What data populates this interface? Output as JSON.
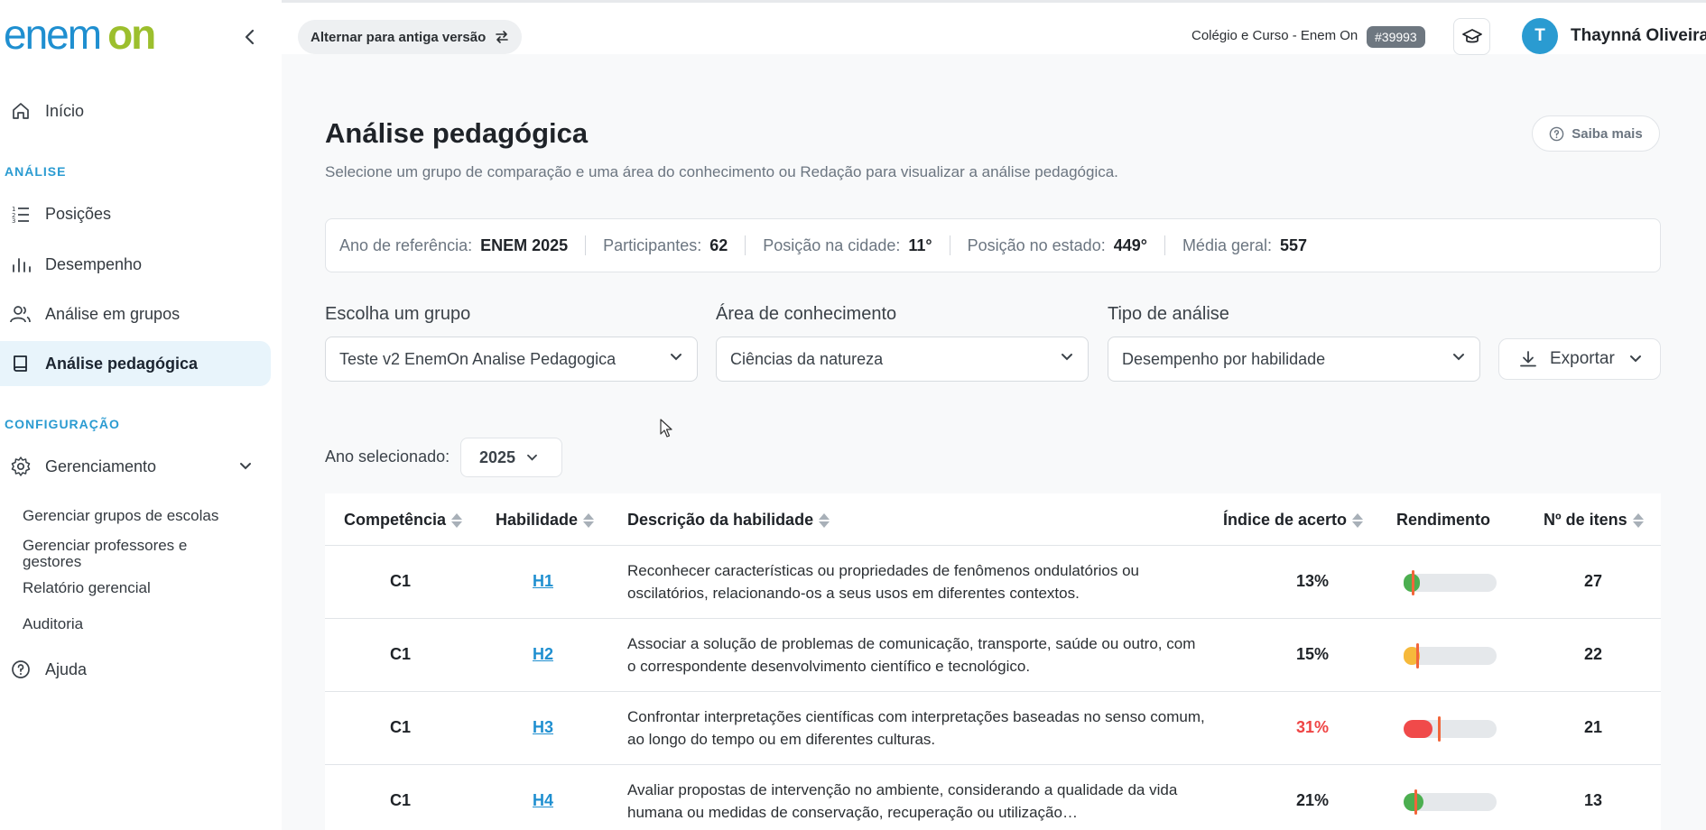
{
  "logo": {
    "part1": "enem",
    "part2": "on"
  },
  "sidebar": {
    "inicio": "Início",
    "section_analise": "ANÁLISE",
    "posicoes": "Posições",
    "desempenho": "Desempenho",
    "analise_grupos": "Análise em grupos",
    "analise_pedagogica": "Análise pedagógica",
    "section_config": "CONFIGURAÇÃO",
    "gerenciamento": "Gerenciamento",
    "sub_grupos": "Gerenciar grupos de escolas",
    "sub_professores": "Gerenciar professores e gestores",
    "sub_relatorio": "Relatório gerencial",
    "sub_auditoria": "Auditoria",
    "ajuda": "Ajuda"
  },
  "header": {
    "alt_version": "Alternar para antiga versão",
    "school_name": "Colégio e Curso - Enem On",
    "school_id": "#39993",
    "avatar_letter": "T",
    "user_name": "Thaynná Oliveira"
  },
  "page": {
    "title": "Análise pedagógica",
    "subtitle": "Selecione um grupo de comparação e uma área do conhecimento ou Redação para visualizar a análise pedagógica.",
    "saiba_mais": "Saiba mais"
  },
  "stats": {
    "ano_label": "Ano de referência:",
    "ano_value": "ENEM 2025",
    "part_label": "Participantes:",
    "part_value": "62",
    "cidade_label": "Posição na cidade:",
    "cidade_value": "11°",
    "estado_label": "Posição no estado:",
    "estado_value": "449°",
    "media_label": "Média geral:",
    "media_value": "557"
  },
  "filters": {
    "grupo_label": "Escolha um grupo",
    "grupo_value": "Teste v2 EnemOn Analise Pedagogica",
    "area_label": "Área de conhecimento",
    "area_value": "Ciências da natureza",
    "tipo_label": "Tipo de análise",
    "tipo_value": "Desempenho por habilidade",
    "export_label": "Exportar",
    "year_label": "Ano selecionado:",
    "year_value": "2025"
  },
  "table": {
    "headers": {
      "competencia": "Competência",
      "habilidade": "Habilidade",
      "descricao": "Descrição da habilidade",
      "indice": "Índice de acerto",
      "rendimento": "Rendimento",
      "itens": "Nº de itens"
    },
    "rows": [
      {
        "competencia": "C1",
        "habilidade": "H1",
        "descricao": "Reconhecer características ou propriedades de fenômenos ondulatórios ou oscilatórios, relacionando-os a seus usos em diferentes contextos.",
        "indice": "13%",
        "itens": "27",
        "perf": 0.09,
        "ref": 0.09,
        "color": "#4caf50",
        "idx_color": "#1f2328"
      },
      {
        "competencia": "C1",
        "habilidade": "H2",
        "descricao": "Associar a solução de problemas de comunicação, transporte, saúde ou outro, com o correspondente desenvolvimento científico e tecnológico.",
        "indice": "15%",
        "itens": "22",
        "perf": 0.12,
        "ref": 0.14,
        "color": "#f6b93b",
        "idx_color": "#1f2328"
      },
      {
        "competencia": "C1",
        "habilidade": "H3",
        "descricao": "Confrontar interpretações científicas com interpretações baseadas no senso comum, ao longo do tempo ou em diferentes culturas.",
        "indice": "31%",
        "itens": "21",
        "perf": 0.31,
        "ref": 0.37,
        "color": "#f04a4a",
        "idx_color": "#ef4444"
      },
      {
        "competencia": "C1",
        "habilidade": "H4",
        "descricao": "Avaliar propostas de intervenção no ambiente, considerando a qualidade da vida humana ou medidas de conservação, recuperação ou utilização…",
        "indice": "21%",
        "itens": "13",
        "perf": 0.21,
        "ref": 0.12,
        "color": "#4caf50",
        "idx_color": "#1f2328"
      }
    ]
  }
}
